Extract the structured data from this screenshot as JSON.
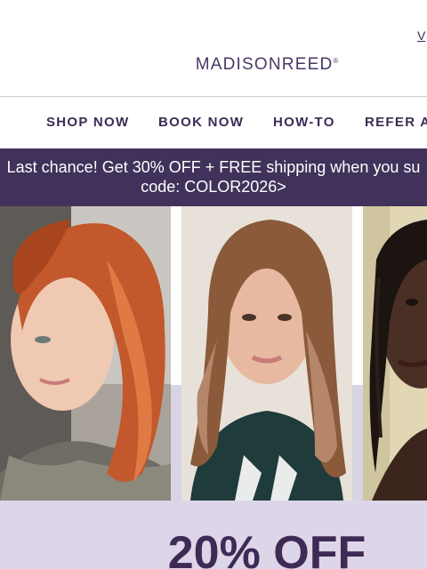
{
  "header": {
    "view_link": "V",
    "logo_text": "MADISONREED",
    "logo_mark": "®"
  },
  "nav": {
    "items": [
      {
        "label": "SHOP NOW"
      },
      {
        "label": "BOOK NOW"
      },
      {
        "label": "HOW-TO"
      },
      {
        "label": "REFER A"
      }
    ]
  },
  "banner": {
    "line1": "Last chance! Get 30% OFF + FREE shipping when you su",
    "line2": "code: COLOR2026>"
  },
  "photos": [
    {
      "icon": "portrait-redhead-photo"
    },
    {
      "icon": "portrait-brunette-photo"
    },
    {
      "icon": "portrait-dark-hair-photo"
    }
  ],
  "promo": {
    "headline": "20% OFF"
  },
  "colors": {
    "brand_purple": "#40325a",
    "text_purple": "#3d2b55",
    "lavender": "#dcd6e8"
  }
}
